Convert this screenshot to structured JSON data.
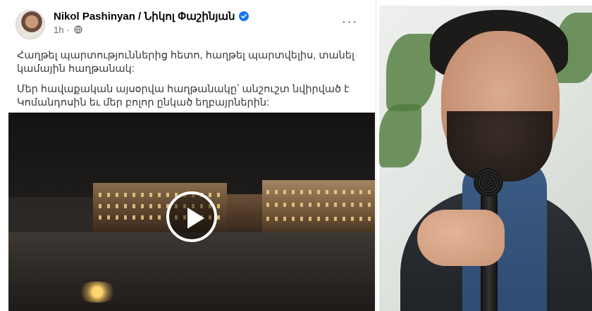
{
  "post": {
    "author": "Nikol Pashinyan / Նիկոլ Փաշինյան",
    "time": "1h",
    "more_label": "···",
    "paragraphs": [
      "Հաղթել պարտություններից հետո, հաղթել պարտվելիս, տանել կամային հաղթանակ:",
      "Մեր հավաքական այսօրվա հաղթանակը՝ անշուշտ նվիրված է Կոմանդոսին եւ մեր բոլոր ընկած եղբայրներին:"
    ]
  },
  "icons": {
    "verified": "verified-badge-icon",
    "audience": "globe-icon",
    "more": "more-options-icon",
    "play": "play-icon"
  },
  "colors": {
    "verified": "#1877f2",
    "text": "#050505",
    "secondary_text": "#65676b"
  }
}
